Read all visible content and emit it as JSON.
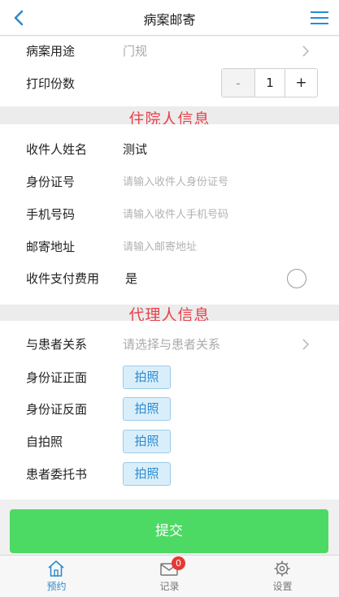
{
  "header": {
    "title": "病案邮寄",
    "back_icon": "chevron-left-icon",
    "menu_icon": "menu-icon",
    "accent_color": "#2c8bd0"
  },
  "form": {
    "purpose": {
      "label": "病案用途",
      "value": "门规"
    },
    "copies": {
      "label": "打印份数",
      "minus": "-",
      "value": "1",
      "plus": "+"
    }
  },
  "inpatient_section": {
    "title": "住院人信息",
    "title_color": "#e8414b",
    "name": {
      "label": "收件人姓名",
      "value": "测试"
    },
    "id_number": {
      "label": "身份证号",
      "placeholder": "请输入收件人身份证号"
    },
    "phone": {
      "label": "手机号码",
      "placeholder": "请输入收件人手机号码"
    },
    "address": {
      "label": "邮寄地址",
      "placeholder": "请输入邮寄地址"
    },
    "pay_on_delivery": {
      "label": "收件支付费用",
      "value": "是"
    }
  },
  "agent_section": {
    "title": "代理人信息",
    "relation": {
      "label": "与患者关系",
      "placeholder": "请选择与患者关系"
    },
    "id_front": {
      "label": "身份证正面",
      "button": "拍照"
    },
    "id_back": {
      "label": "身份证反面",
      "button": "拍照"
    },
    "selfie": {
      "label": "自拍照",
      "button": "拍照"
    },
    "authorization": {
      "label": "患者委托书",
      "button": "拍照"
    }
  },
  "submit": {
    "label": "提交",
    "color": "#4cd964"
  },
  "tabbar": {
    "tabs": [
      {
        "label": "预约",
        "icon": "home-icon",
        "active": true
      },
      {
        "label": "记录",
        "icon": "mail-icon",
        "badge": "0"
      },
      {
        "label": "设置",
        "icon": "gear-icon"
      }
    ]
  }
}
